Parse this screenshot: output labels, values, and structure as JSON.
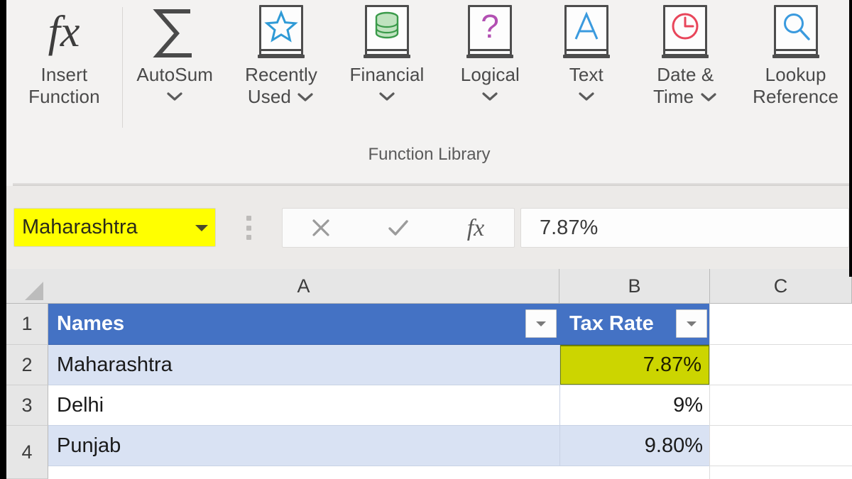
{
  "ribbon": {
    "group_caption": "Function Library",
    "buttons": [
      {
        "label_line1": "Insert",
        "label_line2": "Function",
        "icon": "fx-icon",
        "has_chevron": false
      },
      {
        "label_line1": "AutoSum",
        "label_line2": "",
        "icon": "sigma-icon",
        "has_chevron": true
      },
      {
        "label_line1": "Recently",
        "label_line2": "Used",
        "icon": "star-book-icon",
        "has_chevron": true
      },
      {
        "label_line1": "Financial",
        "label_line2": "",
        "icon": "database-book-icon",
        "has_chevron": true
      },
      {
        "label_line1": "Logical",
        "label_line2": "",
        "icon": "question-book-icon",
        "has_chevron": true
      },
      {
        "label_line1": "Text",
        "label_line2": "",
        "icon": "letter-a-book-icon",
        "has_chevron": true
      },
      {
        "label_line1": "Date &",
        "label_line2": "Time",
        "icon": "clock-book-icon",
        "has_chevron": true
      },
      {
        "label_line1": "Lookup",
        "label_line2": "Reference",
        "icon": "magnifier-book-icon",
        "has_chevron": true
      }
    ]
  },
  "formula_bar": {
    "name_box_value": "Maharashtra",
    "name_box_bg": "#FFFF00",
    "cancel_label": "✕",
    "enter_label": "✓",
    "fx_label": "fx",
    "formula_value": "7.87%"
  },
  "grid": {
    "column_headers": [
      "A",
      "B",
      "C"
    ],
    "row_headers": [
      "1",
      "2",
      "3",
      "4"
    ],
    "table_header_bg": "#4472C4",
    "active_cell_bg": "#CCD500",
    "active_cell_border": "#6F8000",
    "band_color": "#D9E2F3",
    "table": {
      "headers": [
        "Names",
        "Tax Rate"
      ],
      "rows": [
        {
          "name": "Maharashtra",
          "tax_rate": "7.87%"
        },
        {
          "name": "Delhi",
          "tax_rate": "9%"
        },
        {
          "name": "Punjab",
          "tax_rate": "9.80%"
        }
      ]
    }
  }
}
